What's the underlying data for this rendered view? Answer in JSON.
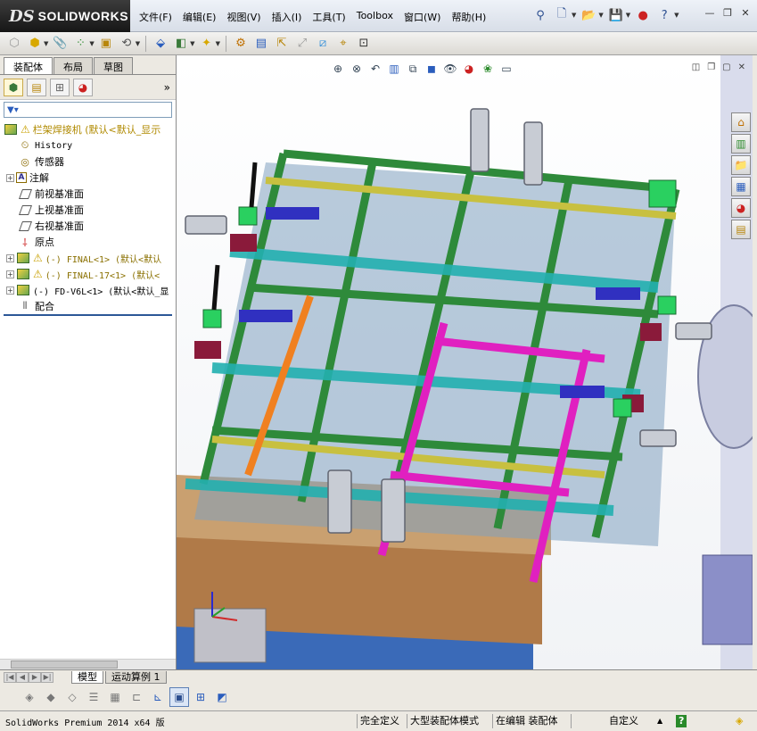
{
  "app": {
    "logo_prefix": "DS",
    "logo_name": "SOLIDWORKS"
  },
  "menu": [
    {
      "label": "文件(F)"
    },
    {
      "label": "编辑(E)"
    },
    {
      "label": "视图(V)"
    },
    {
      "label": "插入(I)"
    },
    {
      "label": "工具(T)"
    },
    {
      "label": "Toolbox"
    },
    {
      "label": "窗口(W)"
    },
    {
      "label": "帮助(H)"
    }
  ],
  "panel_tabs": [
    {
      "label": "装配体"
    },
    {
      "label": "布局"
    },
    {
      "label": "草图"
    }
  ],
  "tree": {
    "root": "栏架焊接机 (默认<默认_显示",
    "items": [
      {
        "label": "History"
      },
      {
        "label": "传感器"
      },
      {
        "label": "注解"
      },
      {
        "label": "前视基准面"
      },
      {
        "label": "上视基准面"
      },
      {
        "label": "右视基准面"
      },
      {
        "label": "原点"
      },
      {
        "label": "(-) FINAL<1> (默认<默认"
      },
      {
        "label": "(-) FINAL-17<1> (默认<"
      },
      {
        "label": "(-) FD-V6L<1> (默认<默认_显"
      },
      {
        "label": "配合"
      }
    ]
  },
  "bottom_tabs": [
    {
      "label": "模型"
    },
    {
      "label": "运动算例 1"
    }
  ],
  "status": {
    "app_version": "SolidWorks Premium 2014 x64 版",
    "fully_defined": "完全定义",
    "large_assembly": "大型装配体模式",
    "editing": "在编辑 装配体",
    "custom": "自定义"
  }
}
